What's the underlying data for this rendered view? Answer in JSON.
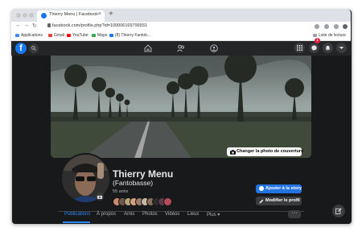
{
  "browser": {
    "tab_title": "Thierry Menu | Facebook",
    "tab_close": "×",
    "new_tab": "+",
    "url": "facebook.com/profile.php?id=100006169799931",
    "bookmarks": [
      "Applications",
      "Gmail",
      "YouTube",
      "Maps",
      "(8) Thierry Fantob..."
    ],
    "reading_list": "Liste de lecture"
  },
  "facebook": {
    "logo": "f",
    "notification_count": "1",
    "cover_button": "Changer la photo de couverture",
    "profile": {
      "name": "Thierry Menu",
      "alias": "(Fantobasse)",
      "friends": "55 amis"
    },
    "actions": {
      "add_story": "Ajouter à la story",
      "edit_profile": "Modifier le profil"
    },
    "tabs": [
      "Publications",
      "À propos",
      "Amis",
      "Photos",
      "Vidéos",
      "Lieux",
      "Plus ▾"
    ],
    "more_label": "···",
    "colors": {
      "brand": "#1877f2",
      "accent": "#2d88ff",
      "background": "#18191a"
    }
  }
}
